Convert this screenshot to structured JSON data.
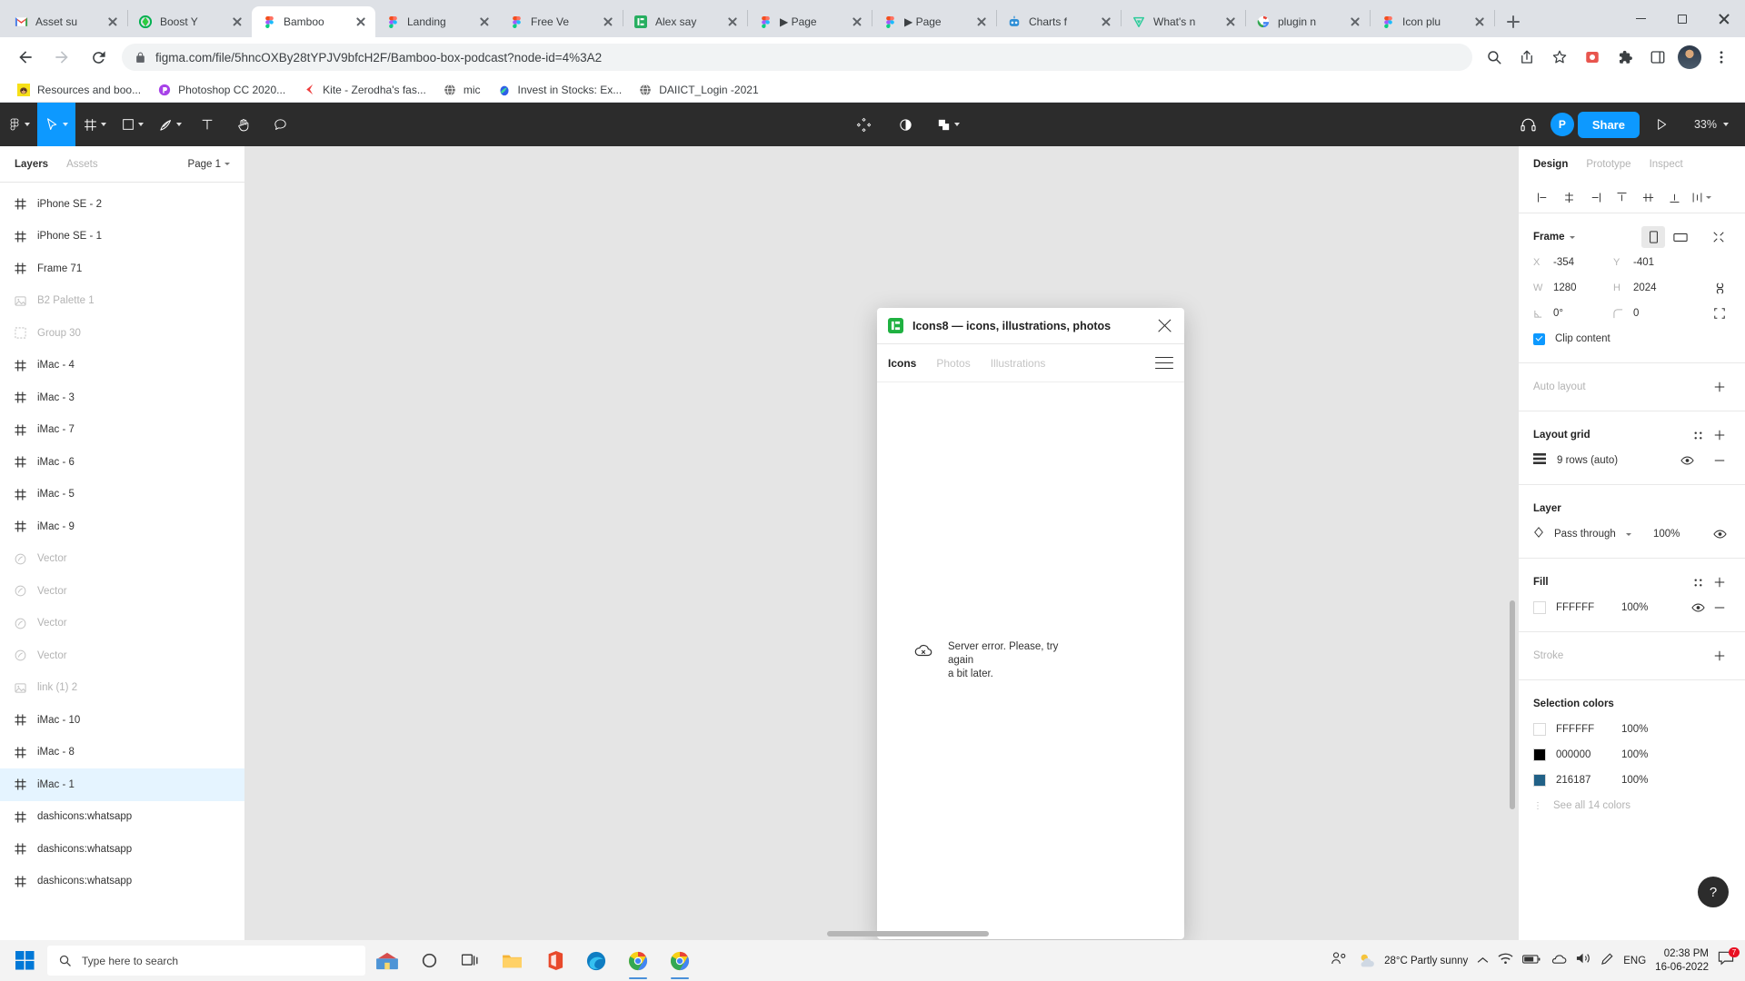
{
  "browser": {
    "tabs": [
      {
        "title": "Asset su",
        "favicon": "gmail-icon",
        "active": false,
        "sep_after": true
      },
      {
        "title": "Boost Y",
        "favicon": "boost-icon",
        "active": false,
        "sep_after": false
      },
      {
        "title": "Bamboo",
        "favicon": "figma-icon",
        "active": true,
        "sep_after": false
      },
      {
        "title": "Landing",
        "favicon": "figma-icon",
        "active": false,
        "sep_after": false
      },
      {
        "title": "Free Ve",
        "favicon": "figma-icon",
        "active": false,
        "sep_after": true
      },
      {
        "title": "Alex say",
        "favicon": "notion-green-icon",
        "active": false,
        "sep_after": true
      },
      {
        "title": "▶ Page",
        "favicon": "figma-icon",
        "active": false,
        "sep_after": true
      },
      {
        "title": "▶ Page",
        "favicon": "figma-icon",
        "active": false,
        "sep_after": true
      },
      {
        "title": "Charts f",
        "favicon": "robot-icon",
        "active": false,
        "sep_after": true
      },
      {
        "title": "What's n",
        "favicon": "vectary-icon",
        "active": false,
        "sep_after": true
      },
      {
        "title": "plugin n",
        "favicon": "google-icon",
        "active": false,
        "sep_after": true
      },
      {
        "title": "Icon plu",
        "favicon": "figma-icon",
        "active": false,
        "sep_after": true
      }
    ],
    "new_tab_label": "+",
    "window_controls": {
      "minimize": "minimize-icon",
      "maximize": "maximize-icon",
      "close": "close-icon"
    },
    "url": "figma.com/file/5hncOXBy28tYPJV9bfcH2F/Bamboo-box-podcast?node-id=4%3A2",
    "nav": {
      "back": "back-arrow-icon",
      "forward": "forward-arrow-icon",
      "reload": "reload-icon",
      "lock": "lock-icon"
    },
    "toolbar_icons": [
      "search-icon",
      "share-icon",
      "bookmark-star-icon",
      "extension-puzzle-icon",
      "sidepanel-icon",
      "menu-dots-icon"
    ],
    "bookmarks": [
      {
        "label": "Resources and boo...",
        "icon": "monkey-icon"
      },
      {
        "label": "Photoshop CC 2020...",
        "icon": "purple-circle-icon"
      },
      {
        "label": "Kite - Zerodha's fas...",
        "icon": "kite-icon"
      },
      {
        "label": "mic",
        "icon": "globe-icon"
      },
      {
        "label": "Invest in Stocks: Ex...",
        "icon": "blue-drop-icon"
      },
      {
        "label": "DAIICT_Login -2021",
        "icon": "globe-icon"
      }
    ]
  },
  "figma": {
    "toolbar": {
      "menu": "figma-menu-icon",
      "tools": [
        "move-tool-icon",
        "frame-tool-icon",
        "shape-tool-icon",
        "pen-tool-icon",
        "text-tool-icon",
        "hand-tool-icon",
        "comment-tool-icon"
      ],
      "center_icons": [
        "components-icon",
        "mask-icon",
        "boolean-icon"
      ],
      "headphones": "headphones-icon",
      "avatar_initial": "P",
      "share_label": "Share",
      "present": "play-icon",
      "zoom": "33%"
    },
    "left_panel": {
      "tabs": [
        {
          "label": "Layers",
          "active": true
        },
        {
          "label": "Assets",
          "active": false
        }
      ],
      "page": "Page 1",
      "layers": [
        {
          "name": "iPhone SE - 2",
          "icon": "frame-icon",
          "dim": false,
          "selected": false
        },
        {
          "name": "iPhone SE - 1",
          "icon": "frame-icon",
          "dim": false,
          "selected": false
        },
        {
          "name": "Frame 71",
          "icon": "frame-icon",
          "dim": false,
          "selected": false
        },
        {
          "name": "B2 Palette 1",
          "icon": "image-icon",
          "dim": true,
          "selected": false
        },
        {
          "name": "Group 30",
          "icon": "group-icon",
          "dim": true,
          "selected": false
        },
        {
          "name": "iMac - 4",
          "icon": "frame-icon",
          "dim": false,
          "selected": false
        },
        {
          "name": "iMac - 3",
          "icon": "frame-icon",
          "dim": false,
          "selected": false
        },
        {
          "name": "iMac - 7",
          "icon": "frame-icon",
          "dim": false,
          "selected": false
        },
        {
          "name": "iMac - 6",
          "icon": "frame-icon",
          "dim": false,
          "selected": false
        },
        {
          "name": "iMac - 5",
          "icon": "frame-icon",
          "dim": false,
          "selected": false
        },
        {
          "name": "iMac - 9",
          "icon": "frame-icon",
          "dim": false,
          "selected": false
        },
        {
          "name": "Vector",
          "icon": "vector-icon",
          "dim": true,
          "selected": false
        },
        {
          "name": "Vector",
          "icon": "vector-icon",
          "dim": true,
          "selected": false
        },
        {
          "name": "Vector",
          "icon": "vector-icon",
          "dim": true,
          "selected": false
        },
        {
          "name": "Vector",
          "icon": "vector-icon",
          "dim": true,
          "selected": false
        },
        {
          "name": "link (1) 2",
          "icon": "image-icon",
          "dim": true,
          "selected": false
        },
        {
          "name": "iMac - 10",
          "icon": "frame-icon",
          "dim": false,
          "selected": false
        },
        {
          "name": "iMac - 8",
          "icon": "frame-icon",
          "dim": false,
          "selected": false
        },
        {
          "name": "iMac - 1",
          "icon": "frame-icon",
          "dim": false,
          "selected": true
        },
        {
          "name": "dashicons:whatsapp",
          "icon": "frame-icon",
          "dim": false,
          "selected": false
        },
        {
          "name": "dashicons:whatsapp",
          "icon": "frame-icon",
          "dim": false,
          "selected": false
        },
        {
          "name": "dashicons:whatsapp",
          "icon": "frame-icon",
          "dim": false,
          "selected": false
        }
      ]
    },
    "plugin": {
      "title": "Icons8 — icons, illustrations, photos",
      "logo": "icons8-logo-icon",
      "close": "close-icon",
      "tabs": [
        {
          "label": "Icons",
          "active": true
        },
        {
          "label": "Photos",
          "active": false
        },
        {
          "label": "Illustrations",
          "active": false
        }
      ],
      "menu": "hamburger-menu-icon",
      "error": {
        "icon": "cloud-error-icon",
        "line1": "Server error. Please, try again",
        "line2": "a bit later."
      }
    },
    "right_panel": {
      "tabs": [
        {
          "label": "Design",
          "active": true
        },
        {
          "label": "Prototype",
          "active": false
        },
        {
          "label": "Inspect",
          "active": false
        }
      ],
      "align_icons": [
        "align-left-icon",
        "align-horizontal-center-icon",
        "align-right-icon",
        "align-top-icon",
        "align-vertical-center-icon",
        "align-bottom-icon",
        "distribute-icon"
      ],
      "frame": {
        "label": "Frame",
        "orientation_portrait": "portrait-icon",
        "orientation_landscape": "landscape-icon",
        "resize_to_fit": "resize-to-fit-icon",
        "x_key": "X",
        "x_value": "-354",
        "y_key": "Y",
        "y_value": "-401",
        "w_key": "W",
        "w_value": "1280",
        "h_key": "H",
        "h_value": "2024",
        "rotation_value": "0°",
        "corner_value": "0",
        "constrain_icon": "constrain-proportions-icon",
        "independent_corners_icon": "independent-corners-icon",
        "clip_content_label": "Clip content",
        "clip_content_checked": true
      },
      "auto_layout": {
        "label": "Auto layout",
        "add": "plus-icon"
      },
      "layout_grid": {
        "label": "Layout grid",
        "settings": "grid-settings-icon",
        "add": "plus-icon",
        "item_icon": "rows-icon",
        "item_label": "9 rows (auto)",
        "visible": "eye-icon",
        "remove": "minus-icon"
      },
      "layer": {
        "label": "Layer",
        "blend_icon": "blend-mode-icon",
        "blend_mode": "Pass through",
        "opacity": "100%",
        "visible": "eye-icon"
      },
      "fill": {
        "label": "Fill",
        "settings": "style-settings-icon",
        "add": "plus-icon",
        "items": [
          {
            "hex": "FFFFFF",
            "opacity": "100%",
            "color": "#FFFFFF"
          }
        ],
        "visible": "eye-icon",
        "remove": "minus-icon"
      },
      "stroke": {
        "label": "Stroke",
        "add": "plus-icon"
      },
      "selection_colors": {
        "label": "Selection colors",
        "items": [
          {
            "hex": "FFFFFF",
            "opacity": "100%",
            "color": "#FFFFFF"
          },
          {
            "hex": "000000",
            "opacity": "100%",
            "color": "#000000"
          },
          {
            "hex": "216187",
            "opacity": "100%",
            "color": "#216187"
          }
        ],
        "see_all_label": "See all 14 colors"
      },
      "help_label": "?"
    }
  },
  "taskbar": {
    "start": "windows-start-icon",
    "search_placeholder": "Type here to search",
    "search_icon": "search-icon",
    "apps": [
      "widgets-icon",
      "cortana-icon",
      "task-view-icon",
      "file-explorer-icon",
      "office-icon",
      "edge-icon",
      "chrome-icon",
      "chrome-icon"
    ],
    "tray": {
      "people_icon": "people-icon",
      "weather_icon": "partly-sunny-icon",
      "weather_text": "28°C  Partly sunny",
      "chevron_icon": "show-hidden-icons-icon",
      "network_icon": "network-icon",
      "battery_icon": "battery-icon",
      "onedrive_icon": "onedrive-icon",
      "volume_icon": "volume-icon",
      "pen_icon": "pen-icon",
      "language": "ENG",
      "time": "02:38 PM",
      "date": "16-06-2022",
      "notification_icon": "notification-icon",
      "notification_count": "7"
    }
  }
}
